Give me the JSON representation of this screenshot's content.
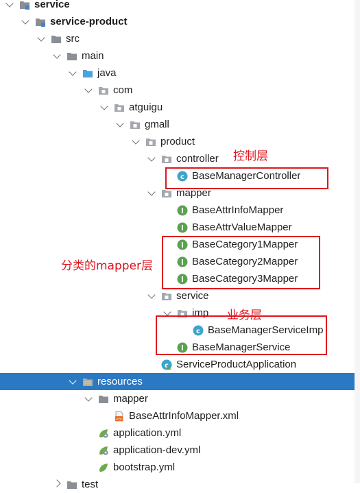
{
  "tree": {
    "items": [
      {
        "label": "service",
        "icon": "module-folder-icon",
        "expanded": true,
        "bold": true,
        "level": 1
      },
      {
        "label": "service-product",
        "icon": "module-folder-icon",
        "expanded": true,
        "bold": true,
        "level": 2
      },
      {
        "label": "src",
        "icon": "folder-icon",
        "expanded": true,
        "level": 3
      },
      {
        "label": "main",
        "icon": "folder-icon",
        "expanded": true,
        "level": 4
      },
      {
        "label": "java",
        "icon": "source-folder-icon",
        "expanded": true,
        "level": 5
      },
      {
        "label": "com",
        "icon": "package-icon",
        "expanded": true,
        "level": 6
      },
      {
        "label": "atguigu",
        "icon": "package-icon",
        "expanded": true,
        "level": 7
      },
      {
        "label": "gmall",
        "icon": "package-icon",
        "expanded": true,
        "level": 8
      },
      {
        "label": "product",
        "icon": "package-icon",
        "expanded": true,
        "level": 9
      },
      {
        "label": "controller",
        "icon": "package-icon",
        "expanded": true,
        "level": 10
      },
      {
        "label": "BaseManagerController",
        "icon": "class-icon",
        "level": 11
      },
      {
        "label": "mapper",
        "icon": "package-icon",
        "expanded": true,
        "level": 10
      },
      {
        "label": "BaseAttrInfoMapper",
        "icon": "interface-icon",
        "level": 11
      },
      {
        "label": "BaseAttrValueMapper",
        "icon": "interface-icon",
        "level": 11
      },
      {
        "label": "BaseCategory1Mapper",
        "icon": "interface-icon",
        "level": 11
      },
      {
        "label": "BaseCategory2Mapper",
        "icon": "interface-icon",
        "level": 11
      },
      {
        "label": "BaseCategory3Mapper",
        "icon": "interface-icon",
        "level": 11
      },
      {
        "label": "service",
        "icon": "package-icon",
        "expanded": true,
        "level": 10
      },
      {
        "label": "imp",
        "icon": "package-icon",
        "expanded": true,
        "level": 11
      },
      {
        "label": "BaseManagerServiceImp",
        "icon": "class-icon",
        "level": 12
      },
      {
        "label": "BaseManagerService",
        "icon": "interface-icon",
        "level": 11
      },
      {
        "label": "ServiceProductApplication",
        "icon": "spring-boot-class-icon",
        "level": 10
      },
      {
        "label": "resources",
        "icon": "resources-folder-icon",
        "expanded": true,
        "level": 5,
        "selected": true
      },
      {
        "label": "mapper",
        "icon": "folder-icon",
        "expanded": true,
        "level": 6
      },
      {
        "label": "BaseAttrInfoMapper.xml",
        "icon": "xml-file-icon",
        "level": 7
      },
      {
        "label": "application.yml",
        "icon": "yaml-config-icon",
        "level": 6
      },
      {
        "label": "application-dev.yml",
        "icon": "yaml-config-icon",
        "level": 6
      },
      {
        "label": "bootstrap.yml",
        "icon": "yaml-leaf-icon",
        "level": 6
      },
      {
        "label": "test",
        "icon": "folder-icon",
        "expanded": false,
        "level": 4
      }
    ]
  },
  "annotations": [
    {
      "text": "控制层",
      "name": "controller-layer-annotation"
    },
    {
      "text": "分类的mapper层",
      "name": "category-mapper-annotation"
    },
    {
      "text": "业务层",
      "name": "service-layer-annotation"
    }
  ],
  "colors": {
    "selection": "#2b79c2",
    "annotation": "#e0141e",
    "class_icon": "#3fa4c9",
    "interface_icon": "#5aa24f",
    "folder": "#8a8f96",
    "source_folder": "#4aa3df"
  }
}
